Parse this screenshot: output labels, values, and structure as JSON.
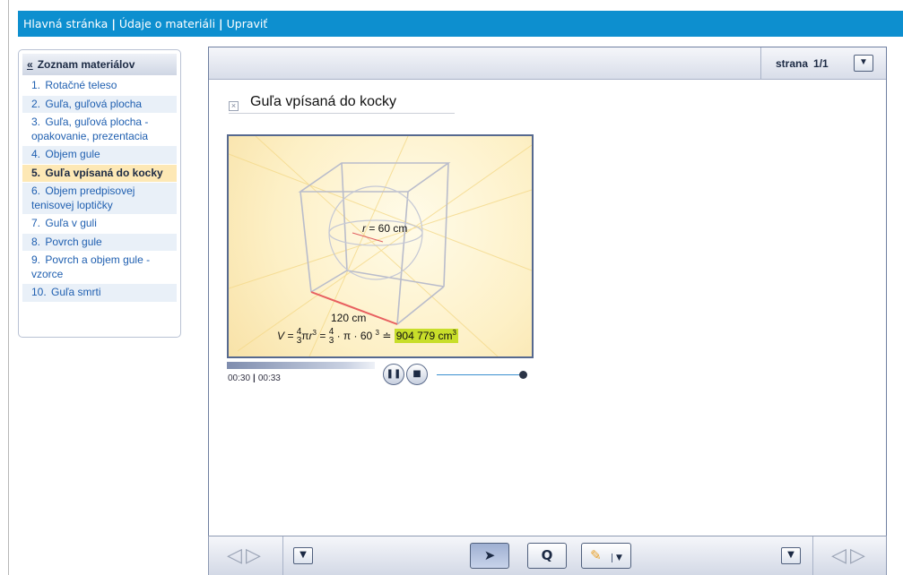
{
  "breadcrumb": {
    "home": "Hlavná stránka",
    "details": "Údaje o materiáli",
    "edit": "Upraviť",
    "separator": "|"
  },
  "sidebar": {
    "back_label": "«",
    "title": "Zoznam materiálov",
    "items": [
      {
        "num": "1.",
        "label": "Rotačné teleso"
      },
      {
        "num": "2.",
        "label": "Guľa, guľová plocha"
      },
      {
        "num": "3.",
        "label": "Guľa, guľová plocha - opakovanie, prezentacia"
      },
      {
        "num": "4.",
        "label": "Objem gule"
      },
      {
        "num": "5.",
        "label": "Guľa vpísaná do kocky"
      },
      {
        "num": "6.",
        "label": "Objem predpisovej tenisovej loptičky"
      },
      {
        "num": "7.",
        "label": "Guľa v guli"
      },
      {
        "num": "8.",
        "label": "Povrch gule"
      },
      {
        "num": "9.",
        "label": "Povrch a objem gule - vzorce"
      },
      {
        "num": "10.",
        "label": "Guľa smrti"
      }
    ],
    "active_index": 4
  },
  "pager": {
    "label": "strana",
    "value": "1/1"
  },
  "document": {
    "title": "Guľa vpísaná do kocky"
  },
  "video": {
    "radius_label": "= 60 cm",
    "radius_var": "r",
    "edge_label": "120 cm",
    "formula_v": "V =",
    "formula_result": "904 779 cm",
    "time_current": "00:30",
    "time_total": "00:33",
    "progress": 0.48
  },
  "toolbar": {
    "pointer_icon": "cursor-arrow-icon",
    "zoom_label": "Q",
    "highlighter_icon": "highlighter-icon"
  },
  "colors": {
    "topbar": "#0d8fcf",
    "active_item": "#fde8b5",
    "result_highlight": "#c8de2a"
  }
}
